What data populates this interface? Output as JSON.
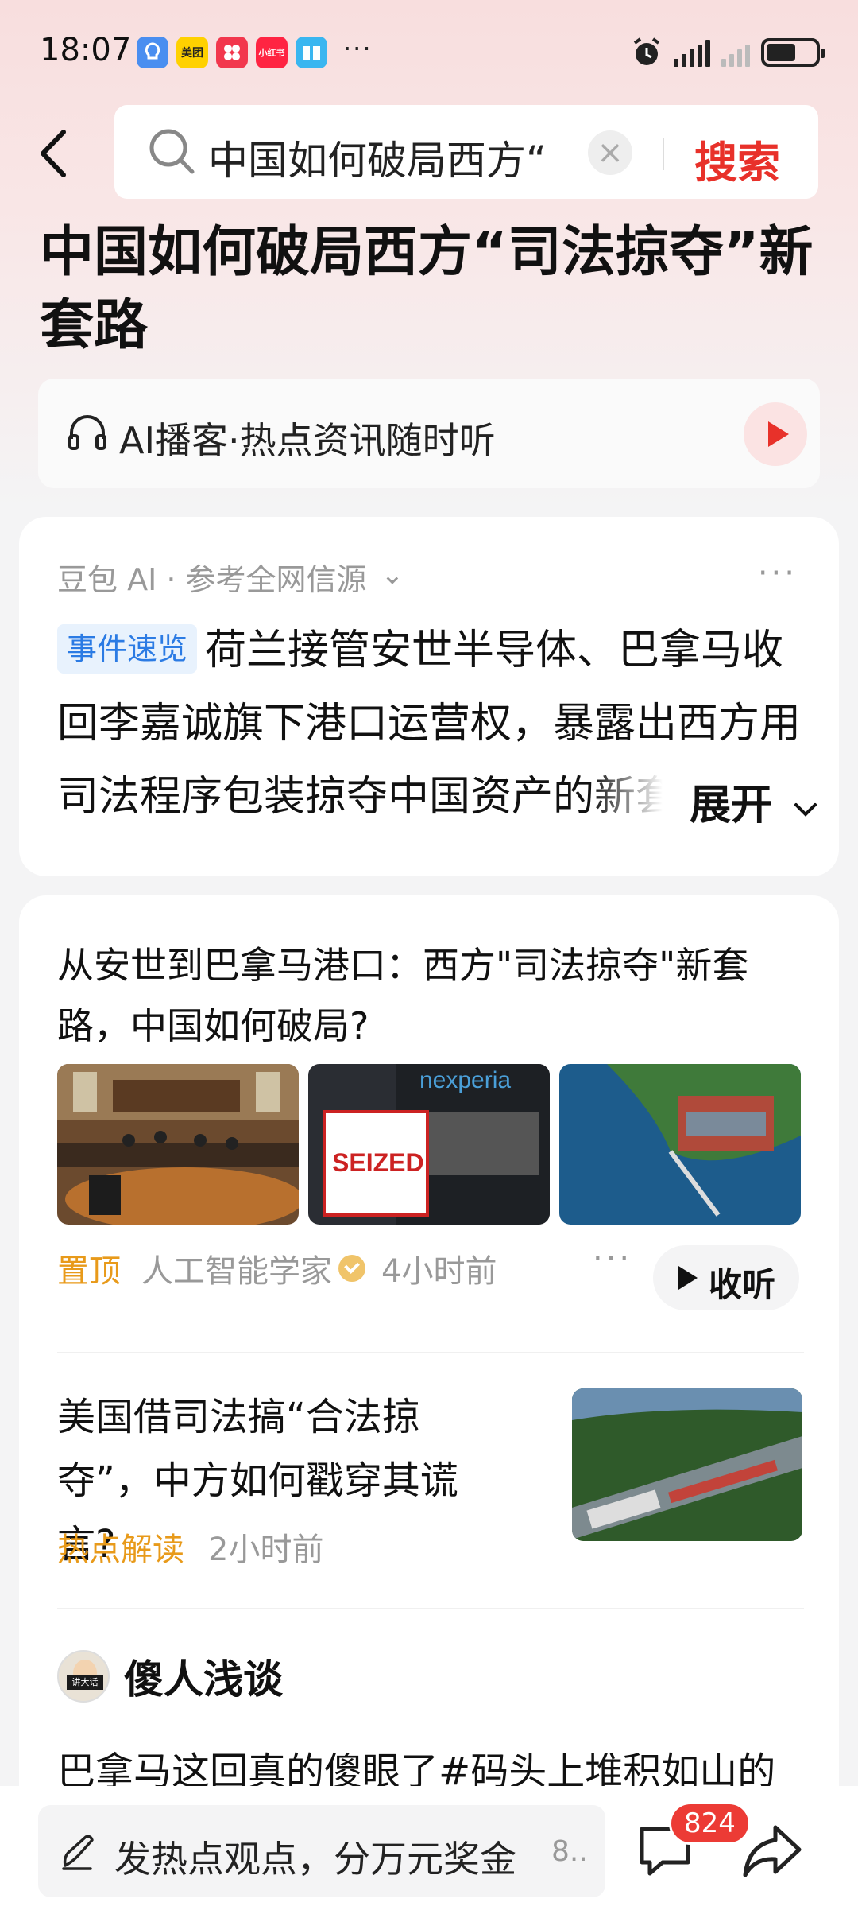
{
  "status_bar": {
    "time": "18:07",
    "apps": [
      {
        "icon": "app-icon-blue",
        "color": "#4a8ef0"
      },
      {
        "icon": "meituan-icon",
        "label": "美团",
        "color": "#ffd100"
      },
      {
        "icon": "app-icon-red-dots",
        "color": "#f2374d"
      },
      {
        "icon": "xiaohongshu-icon",
        "label": "小红书",
        "color": "#ff2442"
      },
      {
        "icon": "book-icon",
        "color": "#3ab6f0"
      }
    ],
    "more": "···"
  },
  "search": {
    "query": "中国如何破局西方“",
    "clear_icon": "×",
    "submit_label": "搜索"
  },
  "headline": "中国如何破局西方“司法掠夺”新套路",
  "podcast": {
    "label": "AI播客·热点资讯随时听"
  },
  "ai_summary": {
    "source": "豆包 AI · 参考全网信源",
    "source_chevron": "⌄",
    "more": "···",
    "tag": "事件速览",
    "text": "荷兰接管安世半导体、巴拿马收回李嘉诚旗下港口运营权，暴露出西方用司法程序包装掠夺中国资产的新套路",
    "expand_label": "展开"
  },
  "news": [
    {
      "title": "从安世到巴拿马港口：西方\"司法掠夺\"新套路，中国如何破局?",
      "pin_label": "置顶",
      "author": "人工智能学家",
      "time": "4小时前",
      "more": "···",
      "listen_label": "收听",
      "image_text": [
        "SEIZED",
        "nexperia"
      ]
    },
    {
      "title": "美国借司法搞“合法掠夺”，中方如何戳穿其谎言?",
      "tag": "热点解读",
      "time": "2小时前"
    }
  ],
  "post": {
    "author": "傻人浅谈",
    "avatar_badge": "讲大话",
    "text": "巴拿马这回真的傻眼了#码头上堆积如山的"
  },
  "bottom_bar": {
    "comment_placeholder": "发热点观点，分万元奖金",
    "comment_suffix": "8..",
    "comment_count": "824"
  },
  "colors": {
    "accent": "#e8312a",
    "tag_blue": "#2b7be4",
    "tag_orange": "#e89a1a"
  }
}
